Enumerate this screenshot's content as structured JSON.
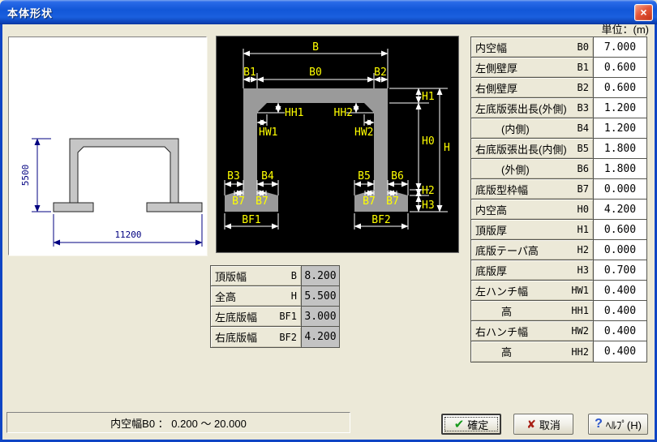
{
  "window": {
    "title": "本体形状",
    "close_glyph": "×",
    "unit_label": "単位：(m)"
  },
  "preview": {
    "height_dim": "5500",
    "width_dim": "11200"
  },
  "diagram": {
    "b": "B",
    "b0": "B0",
    "b1": "B1",
    "b2": "B2",
    "b3": "B3",
    "b4": "B4",
    "b5": "B5",
    "b6": "B6",
    "b7": "B7",
    "bf1": "BF1",
    "bf2": "BF2",
    "h": "H",
    "h0": "H0",
    "h1": "H1",
    "h2": "H2",
    "h3": "H3",
    "hh1": "HH1",
    "hh2": "HH2",
    "hw1": "HW1",
    "hw2": "HW2"
  },
  "summary_table": {
    "rows": [
      {
        "label": "頂版幅",
        "symbol": "B",
        "value": "8.200"
      },
      {
        "label": "全高",
        "symbol": "H",
        "value": "5.500"
      },
      {
        "label": "左底版幅",
        "symbol": "BF1",
        "value": "3.000"
      },
      {
        "label": "右底版幅",
        "symbol": "BF2",
        "value": "4.200"
      }
    ]
  },
  "params_table": {
    "rows": [
      {
        "label": "内空幅",
        "symbol": "B0",
        "value": "7.000"
      },
      {
        "label": "左側壁厚",
        "symbol": "B1",
        "value": "0.600"
      },
      {
        "label": "右側壁厚",
        "symbol": "B2",
        "value": "0.600"
      },
      {
        "label": "左底版張出長(外側)",
        "symbol": "B3",
        "value": "1.200"
      },
      {
        "label": "(内側)",
        "symbol": "B4",
        "value": "1.200"
      },
      {
        "label": "右底版張出長(内側)",
        "symbol": "B5",
        "value": "1.800"
      },
      {
        "label": "(外側)",
        "symbol": "B6",
        "value": "1.800"
      },
      {
        "label": "底版型枠幅",
        "symbol": "B7",
        "value": "0.000"
      },
      {
        "label": "内空高",
        "symbol": "H0",
        "value": "4.200"
      },
      {
        "label": "頂版厚",
        "symbol": "H1",
        "value": "0.600"
      },
      {
        "label": "底版テーパ高",
        "symbol": "H2",
        "value": "0.000"
      },
      {
        "label": "底版厚",
        "symbol": "H3",
        "value": "0.700"
      },
      {
        "label": "左ハンチ幅",
        "symbol": "HW1",
        "value": "0.400"
      },
      {
        "label": "高",
        "symbol": "HH1",
        "value": "0.400"
      },
      {
        "label": "右ハンチ幅",
        "symbol": "HW2",
        "value": "0.400"
      },
      {
        "label": "高",
        "symbol": "HH2",
        "value": "0.400"
      }
    ]
  },
  "status_bar": {
    "text": "内空幅B0 ： 0.200 ～ 20.000"
  },
  "buttons": {
    "ok": "確定",
    "cancel": "取消",
    "help": "ﾍﾙﾌﾟ(H)"
  },
  "colors": {
    "titlebar_blue": "#1257d8",
    "dialog_bg": "#ece9d8",
    "diagram_bg": "#000000",
    "structure_gray": "#9a9a9a",
    "preview_gray": "#c6c6c6",
    "dim_label_yellow": "#ffff00",
    "dim_line_white": "#ffffff",
    "preview_dim_blue": "#000080",
    "ok_check_green": "#169a1c",
    "cancel_x_red": "#a81f16",
    "help_q_blue": "#2a55cc"
  }
}
